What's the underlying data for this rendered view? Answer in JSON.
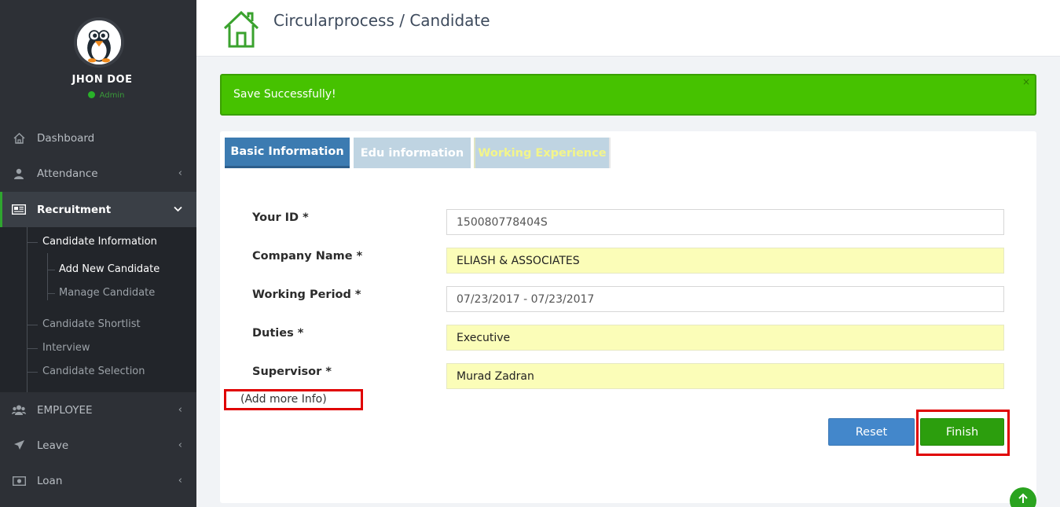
{
  "user": {
    "name": "JHON DOE",
    "role": "Admin"
  },
  "sidebar": {
    "items": [
      {
        "label": "Dashboard",
        "icon": "home-icon"
      },
      {
        "label": "Attendance",
        "icon": "user-icon"
      },
      {
        "label": "Recruitment",
        "icon": "newspaper-icon"
      },
      {
        "label": "EMPLOYEE",
        "icon": "users-icon"
      },
      {
        "label": "Leave",
        "icon": "plane-icon"
      },
      {
        "label": "Loan",
        "icon": "money-icon"
      }
    ],
    "recruitment_sub": [
      "Candidate Information",
      "Candidate Shortlist",
      "Interview",
      "Candidate Selection"
    ],
    "candidate_info_sub": [
      "Add New Candidate",
      "Manage Candidate"
    ]
  },
  "header": {
    "title": "Circularprocess / Candidate"
  },
  "alert": {
    "message": "Save Successfully!",
    "close": "×"
  },
  "tabs": [
    "Basic Information",
    "Edu information",
    "Working Experience"
  ],
  "form": {
    "fields": [
      {
        "label": "Your ID *",
        "value": "150080778404S"
      },
      {
        "label": "Company Name *",
        "value": "ELIASH & ASSOCIATES"
      },
      {
        "label": "Working Period *",
        "value": "07/23/2017 - 07/23/2017"
      },
      {
        "label": "Duties *",
        "value": "Executive"
      },
      {
        "label": "Supervisor *",
        "value": "Murad Zadran"
      }
    ],
    "add_more": "(Add more Info)",
    "reset_label": "Reset",
    "finish_label": "Finish"
  },
  "colors": {
    "sidebar_bg": "#2d3036",
    "success": "#46c200",
    "primary": "#3c7bb1",
    "highlight_input": "#fbfdb8"
  }
}
